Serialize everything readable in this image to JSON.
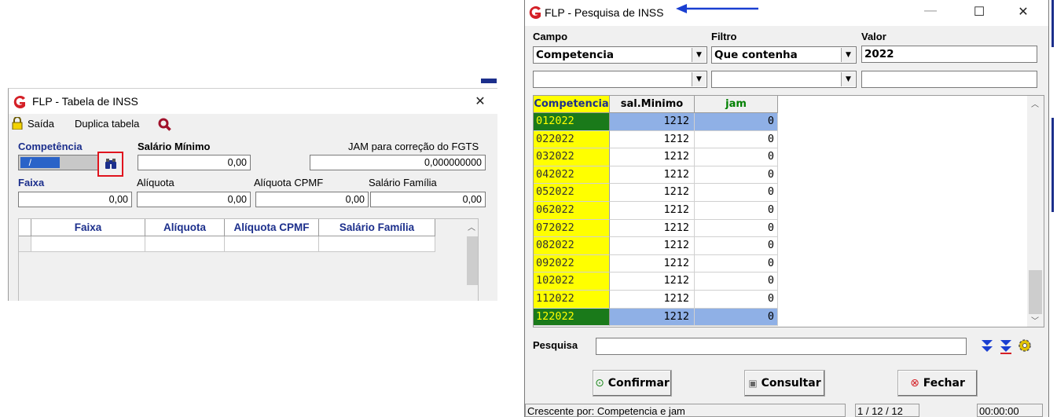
{
  "table_window": {
    "title": "FLP - Tabela de INSS",
    "toolbar": {
      "exit_label": "Saída",
      "duplicate_label": "Duplica tabela"
    },
    "labels": {
      "competencia": "Competência",
      "salario_minimo": "Salário Mínimo",
      "jam": "JAM para correção do FGTS",
      "faixa": "Faixa",
      "aliquota": "Alíquota",
      "aliquota_cpmf": "Alíquota CPMF",
      "salario_familia": "Salário Família"
    },
    "values": {
      "competencia": "  /",
      "salario_minimo": "0,00",
      "jam": "0,000000000",
      "faixa": "0,00",
      "aliquota": "0,00",
      "aliquota_cpmf": "0,00",
      "salario_familia": "0,00"
    },
    "grid_headers": [
      "Faixa",
      "Alíquota",
      "Alíquota CPMF",
      "Salário Família"
    ]
  },
  "search_window": {
    "title": "FLP - Pesquisa de INSS",
    "labels": {
      "campo": "Campo",
      "filtro": "Filtro",
      "valor": "Valor",
      "pesquisa": "Pesquisa"
    },
    "filter1": {
      "campo": "Competencia",
      "filtro": "Que contenha",
      "valor": "2022"
    },
    "filter2": {
      "campo": "",
      "filtro": "",
      "valor": ""
    },
    "grid_headers": [
      "Competencia",
      "sal.Minimo",
      "jam"
    ],
    "header_colors": {
      "competencia_bg": "#ffff00",
      "jam_text": "#008000"
    },
    "rows": [
      {
        "competencia": "012022",
        "sal_minimo": "1212",
        "jam": "0"
      },
      {
        "competencia": "022022",
        "sal_minimo": "1212",
        "jam": "0"
      },
      {
        "competencia": "032022",
        "sal_minimo": "1212",
        "jam": "0"
      },
      {
        "competencia": "042022",
        "sal_minimo": "1212",
        "jam": "0"
      },
      {
        "competencia": "052022",
        "sal_minimo": "1212",
        "jam": "0"
      },
      {
        "competencia": "062022",
        "sal_minimo": "1212",
        "jam": "0"
      },
      {
        "competencia": "072022",
        "sal_minimo": "1212",
        "jam": "0"
      },
      {
        "competencia": "082022",
        "sal_minimo": "1212",
        "jam": "0"
      },
      {
        "competencia": "092022",
        "sal_minimo": "1212",
        "jam": "0"
      },
      {
        "competencia": "102022",
        "sal_minimo": "1212",
        "jam": "0"
      },
      {
        "competencia": "112022",
        "sal_minimo": "1212",
        "jam": "0"
      },
      {
        "competencia": "122022",
        "sal_minimo": "1212",
        "jam": "0"
      }
    ],
    "buttons": {
      "confirm": "Confirmar",
      "consult": "Consultar",
      "close": "Fechar"
    },
    "status": {
      "sort": "Crescente por: Competencia e jam",
      "records": "1 / 12 / 12",
      "time": "00:00:00"
    }
  },
  "colors": {
    "brand_red": "#d42027",
    "header_blue": "#1c2f8c",
    "arrow_blue": "#1a3fd1",
    "highlight_red": "#e0141e"
  }
}
